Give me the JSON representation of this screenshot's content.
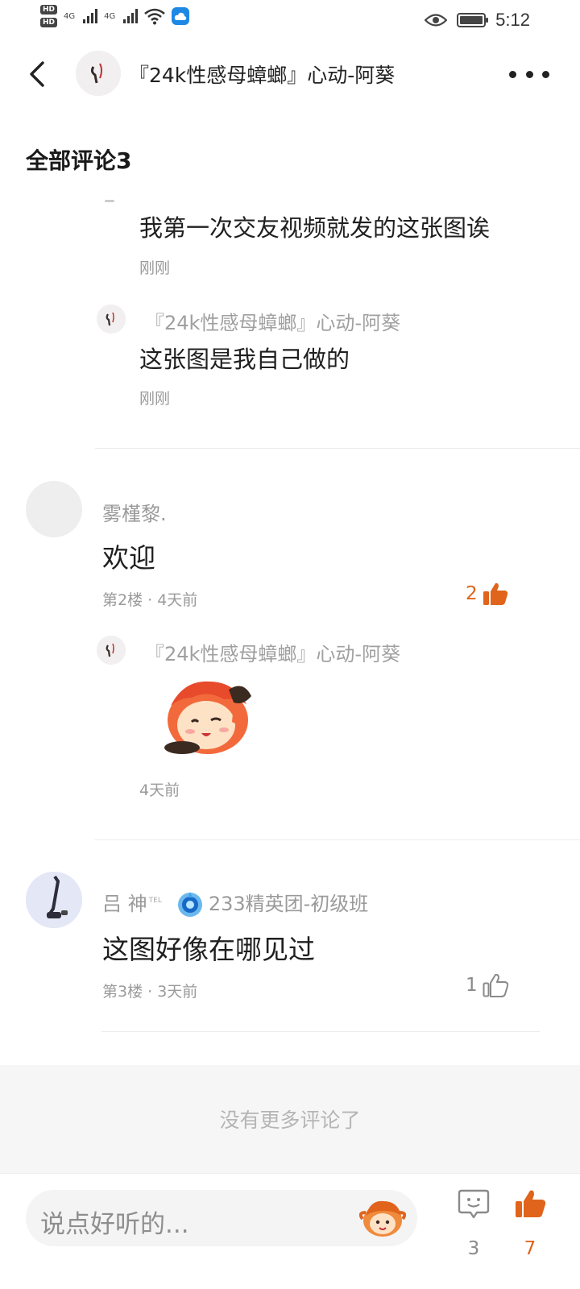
{
  "status_bar": {
    "hd1": "HD",
    "hd2": "HD",
    "net1": "4G",
    "net2": "4G",
    "time": "5:12"
  },
  "header": {
    "title": "『24k性感母蟑螂』心动-阿葵"
  },
  "section_title": "全部评论3",
  "thread1": {
    "replies": [
      {
        "text": "我第一次交友视频就发的这张图诶",
        "time": "刚刚"
      },
      {
        "author": "『24k性感母蟑螂』心动-阿葵",
        "text": "这张图是我自己做的",
        "time": "刚刚"
      }
    ]
  },
  "comment2": {
    "author": "雾槿黎.",
    "text": "欢迎",
    "meta": "第2楼 · 4天前",
    "likes": "2",
    "liked": true,
    "reply": {
      "author": "『24k性感母蟑螂』心动-阿葵",
      "time": "4天前"
    }
  },
  "comment3": {
    "author": "吕 神",
    "tel": "TEL",
    "group": "233精英团-初级班",
    "text": "这图好像在哪见过",
    "meta": "第3楼 · 3天前",
    "likes": "1",
    "liked": false
  },
  "no_more": "没有更多评论了",
  "bottom_bar": {
    "placeholder": "说点好听的...",
    "comment_count": "3",
    "like_count": "7"
  },
  "colors": {
    "accent": "#e0641c",
    "muted": "#9a9a9a"
  }
}
